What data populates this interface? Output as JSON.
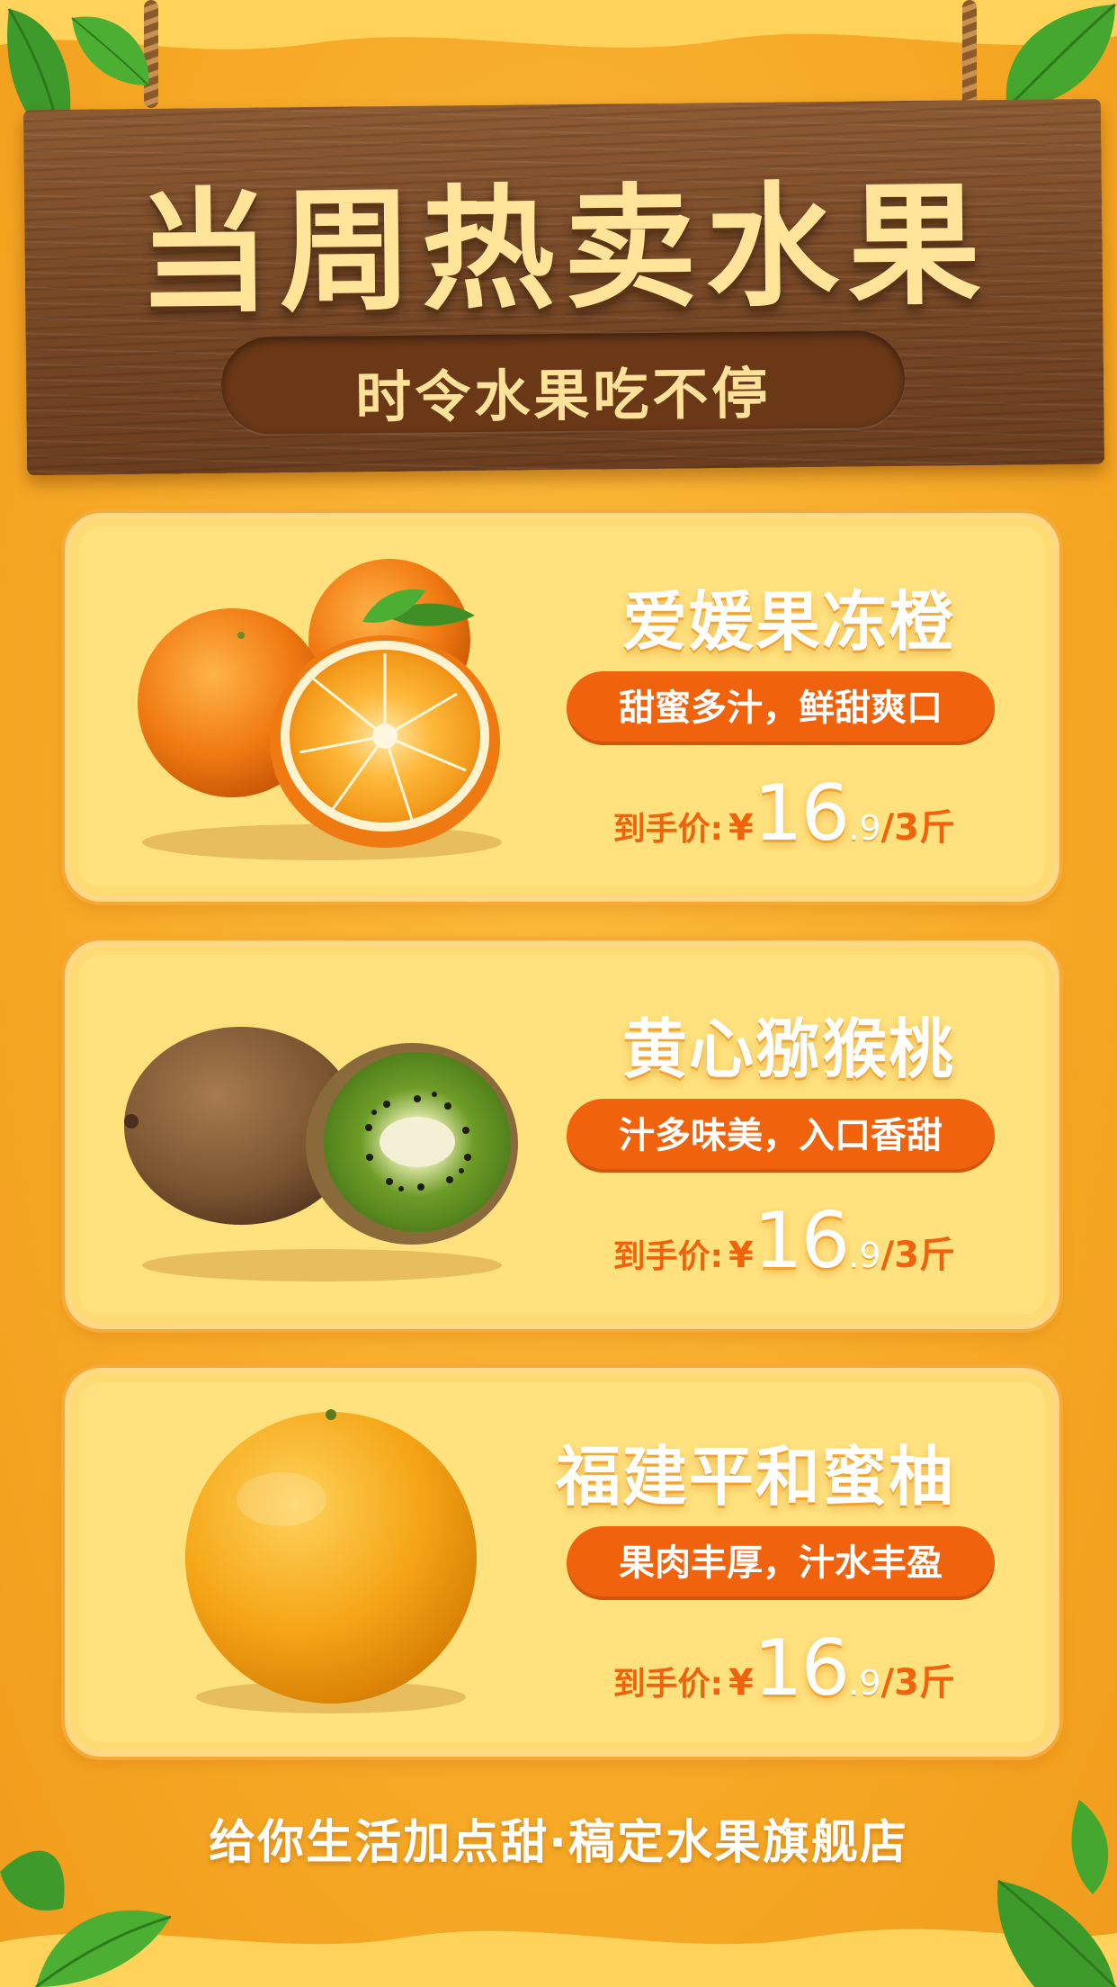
{
  "header": {
    "title": "当周热卖水果",
    "subtitle": "时令水果吃不停"
  },
  "products": [
    {
      "name": "爱媛果冻橙",
      "tagline": "甜蜜多汁，鲜甜爽口",
      "price_label": "到手价:",
      "currency": "¥",
      "price_int": "16",
      "price_dec": ".9",
      "unit": "/3斤",
      "image": "mandarin-orange-image"
    },
    {
      "name": "黄心猕猴桃",
      "tagline": "汁多味美，入口香甜",
      "price_label": "到手价:",
      "currency": "¥",
      "price_int": "16",
      "price_dec": ".9",
      "unit": "/3斤",
      "image": "kiwi-image"
    },
    {
      "name": "福建平和蜜柚",
      "tagline": "果肉丰厚，汁水丰盈",
      "price_label": "到手价:",
      "currency": "¥",
      "price_int": "16",
      "price_dec": ".9",
      "unit": "/3斤",
      "image": "pomelo-image"
    }
  ],
  "footer": {
    "text": "给你生活加点甜·稿定水果旗舰店"
  },
  "colors": {
    "background": "#f5a623",
    "card": "#ffe27e",
    "accent": "#f0620c",
    "sign_text": "#ffe49a",
    "wood": "#7a4a27"
  }
}
